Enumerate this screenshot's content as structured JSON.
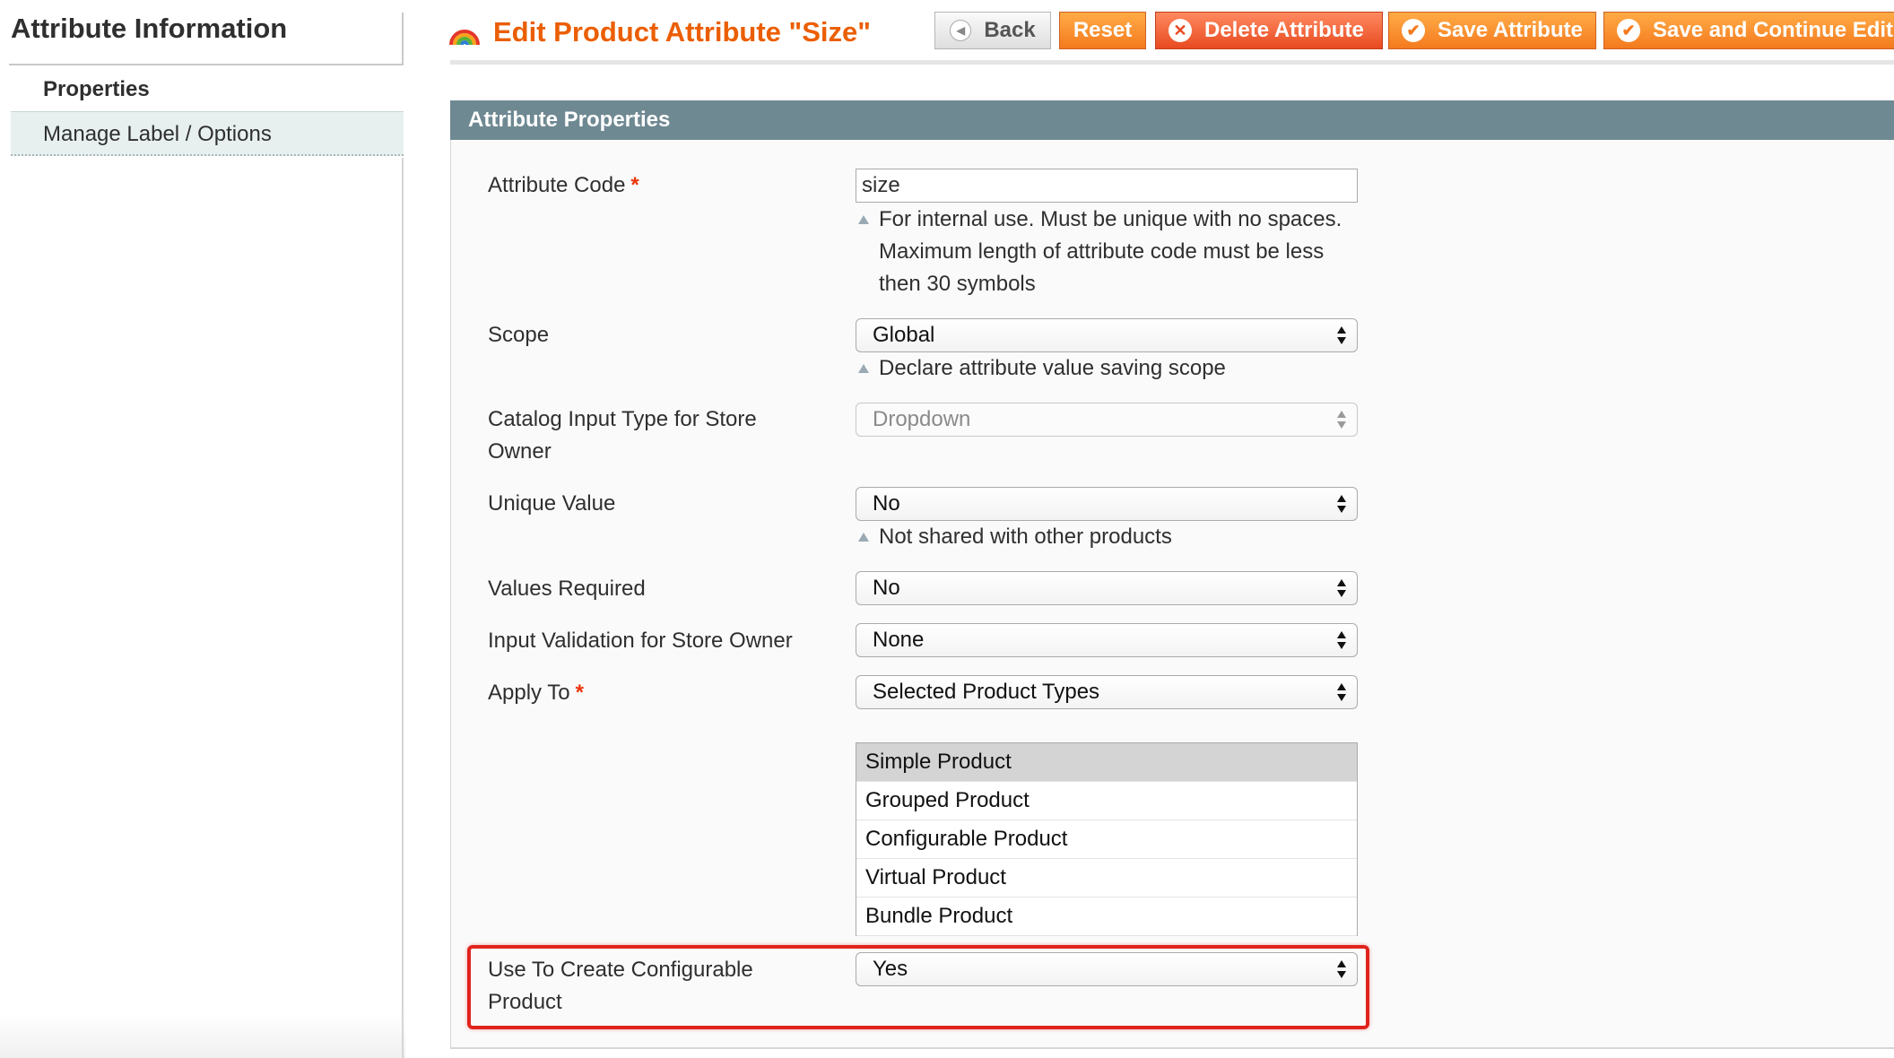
{
  "sidebar": {
    "title": "Attribute Information",
    "items": [
      {
        "label": "Properties"
      },
      {
        "label": "Manage Label / Options"
      }
    ]
  },
  "header": {
    "title": "Edit Product Attribute \"Size\"",
    "icon": "rainbow-icon"
  },
  "buttons": {
    "back": "Back",
    "reset": "Reset",
    "delete": "Delete Attribute",
    "save": "Save Attribute",
    "save_continue": "Save and Continue Edit"
  },
  "section": {
    "title": "Attribute Properties"
  },
  "fields": {
    "attribute_code": {
      "label": "Attribute Code",
      "required_mark": "*",
      "value": "size",
      "note": [
        "For internal use. Must be unique with no spaces.",
        "Maximum length of attribute code must be less",
        "then 30 symbols"
      ]
    },
    "scope": {
      "label": "Scope",
      "value": "Global",
      "note": "Declare attribute value saving scope"
    },
    "catalog_input_type": {
      "label": "Catalog Input Type for Store Owner",
      "value": "Dropdown"
    },
    "unique_value": {
      "label": "Unique Value",
      "value": "No",
      "note": "Not shared with other products"
    },
    "values_required": {
      "label": "Values Required",
      "value": "No"
    },
    "input_validation": {
      "label": "Input Validation for Store Owner",
      "value": "None"
    },
    "apply_to": {
      "label": "Apply To",
      "required_mark": "*",
      "value": "Selected Product Types",
      "options": [
        "Simple Product",
        "Grouped Product",
        "Configurable Product",
        "Virtual Product",
        "Bundle Product"
      ],
      "selected_option": "Simple Product"
    },
    "use_configurable": {
      "label": "Use To Create Configurable Product",
      "value": "Yes"
    }
  },
  "colors": {
    "accent": "#eb5e00",
    "section_header": "#6f8992",
    "highlight": "#e0231c"
  }
}
